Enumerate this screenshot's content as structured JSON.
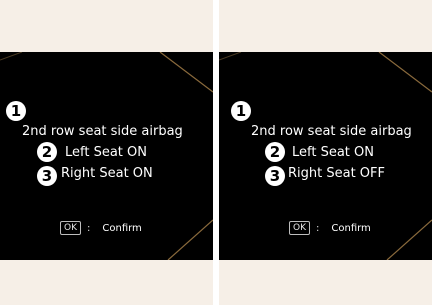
{
  "panels": [
    {
      "markers": {
        "one": "1",
        "two": "2",
        "three": "3"
      },
      "title": "2nd row seat side airbag",
      "left_seat": "Left Seat ON",
      "right_seat": "Right Seat ON",
      "ok_key": "OK",
      "separator": ":",
      "confirm_label": "Confirm"
    },
    {
      "markers": {
        "one": "1",
        "two": "2",
        "three": "3"
      },
      "title": "2nd row seat side airbag",
      "left_seat": "Left Seat ON",
      "right_seat": "Right Seat OFF",
      "ok_key": "OK",
      "separator": ":",
      "confirm_label": "Confirm"
    }
  ],
  "colors": {
    "background": "#f6efe7",
    "screen": "#000000",
    "accent_frame": "#8a6a3c",
    "text": "#ffffff"
  }
}
